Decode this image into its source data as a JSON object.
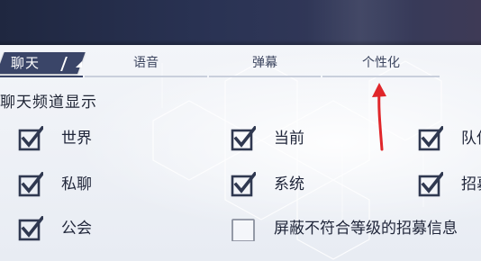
{
  "tabs": {
    "active": {
      "label": "聊天"
    },
    "items": [
      {
        "label": "语音"
      },
      {
        "label": "弹幕"
      },
      {
        "label": "个性化"
      }
    ]
  },
  "section": {
    "title": "聊天频道显示"
  },
  "options": [
    {
      "label": "世界",
      "checked": true
    },
    {
      "label": "当前",
      "checked": true
    },
    {
      "label": "队伍",
      "checked": true
    },
    {
      "label": "私聊",
      "checked": true
    },
    {
      "label": "系统",
      "checked": true
    },
    {
      "label": "招募",
      "checked": true
    },
    {
      "label": "公会",
      "checked": true
    },
    {
      "label": "屏蔽不符合等级的招募信息",
      "checked": false
    }
  ],
  "colors": {
    "header": "#2a3354",
    "tab_active": "#3a4568",
    "checkbox": "#2f3850",
    "annotation": "#e0262a"
  },
  "annotation_icon": "red-arrow-up-icon"
}
